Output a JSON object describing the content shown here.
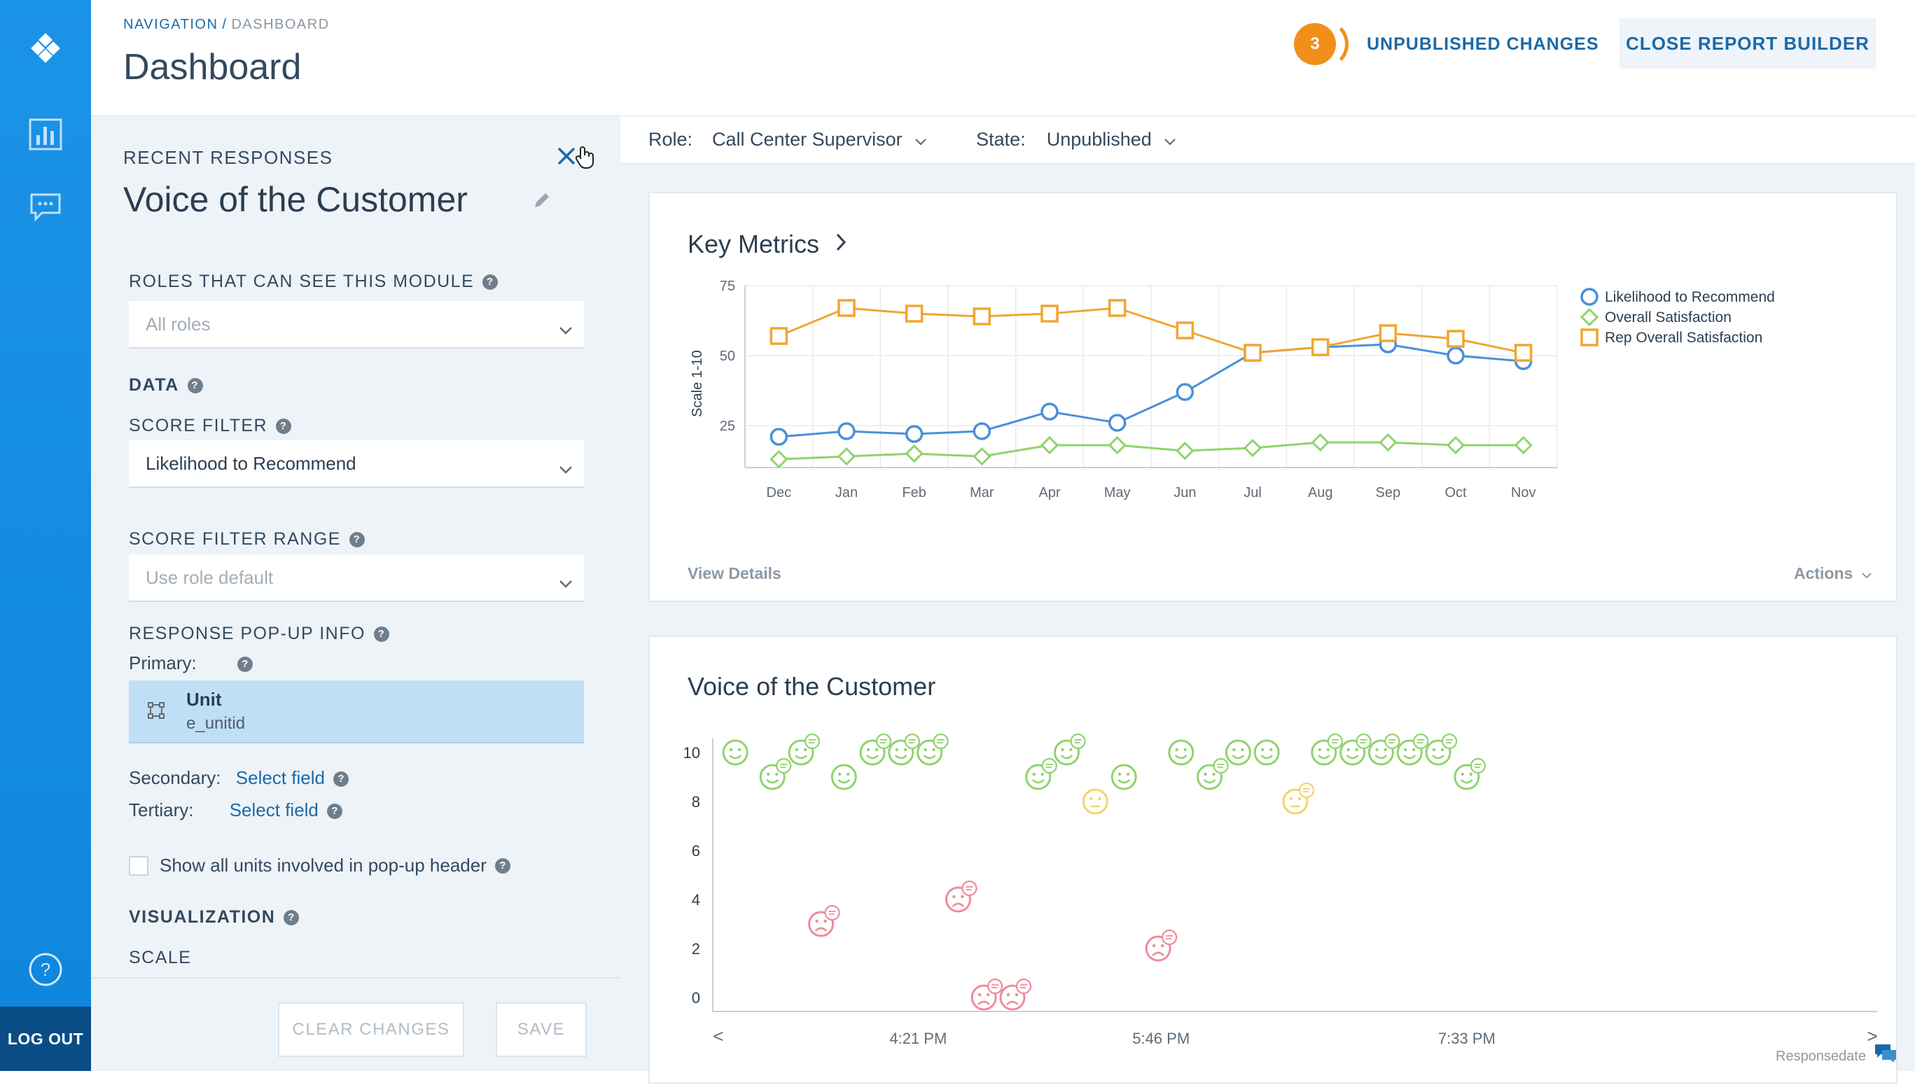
{
  "rail": {
    "icons": [
      "logo-diamond-icon",
      "bar-chart-icon",
      "chat-bubble-icon",
      "help-circle-icon"
    ],
    "logout_label": "LOG OUT"
  },
  "header": {
    "breadcrumb": {
      "parent": "NAVIGATION",
      "separator": "/",
      "current": "DASHBOARD"
    },
    "title": "Dashboard",
    "unpublished_count": "3",
    "unpublished_label": "UNPUBLISHED CHANGES",
    "close_builder_label": "CLOSE REPORT BUILDER"
  },
  "panel": {
    "section": "RECENT RESPONSES",
    "module_title": "Voice of the Customer",
    "roles_label": "ROLES THAT CAN SEE THIS MODULE",
    "roles_placeholder": "All roles",
    "data_label": "DATA",
    "score_filter_label": "SCORE FILTER",
    "score_filter_value": "Likelihood to Recommend",
    "score_range_label": "SCORE FILTER RANGE",
    "score_range_placeholder": "Use role default",
    "popup_label": "RESPONSE POP-UP INFO",
    "primary_label": "Primary:",
    "primary_field_name": "Unit",
    "primary_field_id": "e_unitid",
    "secondary_label": "Secondary:",
    "tertiary_label": "Tertiary:",
    "select_field": "Select field",
    "show_units_label": "Show all units involved in pop-up header",
    "show_units_checked": false,
    "visualization_label": "VISUALIZATION",
    "scale_label": "SCALE",
    "clear_label": "CLEAR CHANGES",
    "save_label": "SAVE"
  },
  "filters": {
    "role_label": "Role:",
    "role_value": "Call Center Supervisor",
    "state_label": "State:",
    "state_value": "Unpublished"
  },
  "key_metrics": {
    "title": "Key Metrics",
    "view_details": "View Details",
    "actions": "Actions"
  },
  "voc": {
    "title": "Voice of the Customer",
    "footer_brand": "Responsedate"
  },
  "colors": {
    "blue": "#4a90d9",
    "green": "#8ed46c",
    "orange": "#f0a630",
    "red": "#f08a9c",
    "yellow": "#f5d36a"
  },
  "chart_data": [
    {
      "type": "line",
      "title": "Key Metrics",
      "ylabel": "Scale 1-10",
      "ylim": [
        10,
        75
      ],
      "yticks": [
        25,
        50,
        75
      ],
      "categories": [
        "Dec",
        "Jan",
        "Feb",
        "Mar",
        "Apr",
        "May",
        "Jun",
        "Jul",
        "Aug",
        "Sep",
        "Oct",
        "Nov"
      ],
      "grid": true,
      "legend": "right",
      "series": [
        {
          "name": "Likelihood to Recommend",
          "marker": "circle",
          "color": "#4a90d9",
          "values": [
            21,
            23,
            22,
            23,
            30,
            26,
            37,
            51,
            53,
            54,
            50,
            48
          ]
        },
        {
          "name": "Overall Satisfaction",
          "marker": "diamond",
          "color": "#8ed46c",
          "values": [
            13,
            14,
            15,
            14,
            18,
            18,
            16,
            17,
            19,
            19,
            18,
            18
          ]
        },
        {
          "name": "Rep Overall Satisfaction",
          "marker": "square",
          "color": "#f0a630",
          "values": [
            57,
            67,
            65,
            64,
            65,
            67,
            59,
            51,
            53,
            58,
            56,
            51
          ]
        }
      ]
    },
    {
      "type": "scatter",
      "title": "Voice of the Customer",
      "ylim": [
        0,
        10
      ],
      "yticks": [
        0,
        2,
        4,
        6,
        8,
        10
      ],
      "xlim_minutes": [
        0,
        396
      ],
      "xticks": [
        {
          "label": "4:21 PM",
          "t": 66
        },
        {
          "label": "5:46 PM",
          "t": 151
        },
        {
          "label": "7:33 PM",
          "t": 258
        }
      ],
      "nav_prev": "<",
      "nav_next": ">",
      "points": [
        {
          "t": 2,
          "score": 10,
          "sentiment": "happy",
          "comment": false
        },
        {
          "t": 15,
          "score": 9,
          "sentiment": "happy",
          "comment": true
        },
        {
          "t": 25,
          "score": 10,
          "sentiment": "happy",
          "comment": true
        },
        {
          "t": 32,
          "score": 3,
          "sentiment": "sad",
          "comment": true
        },
        {
          "t": 40,
          "score": 9,
          "sentiment": "happy",
          "comment": false
        },
        {
          "t": 50,
          "score": 10,
          "sentiment": "happy",
          "comment": true
        },
        {
          "t": 60,
          "score": 10,
          "sentiment": "happy",
          "comment": true
        },
        {
          "t": 70,
          "score": 10,
          "sentiment": "happy",
          "comment": true
        },
        {
          "t": 80,
          "score": 4,
          "sentiment": "sad",
          "comment": true
        },
        {
          "t": 89,
          "score": 0,
          "sentiment": "sad",
          "comment": true
        },
        {
          "t": 99,
          "score": 0,
          "sentiment": "sad",
          "comment": true
        },
        {
          "t": 108,
          "score": 9,
          "sentiment": "happy",
          "comment": true
        },
        {
          "t": 118,
          "score": 10,
          "sentiment": "happy",
          "comment": true
        },
        {
          "t": 128,
          "score": 8,
          "sentiment": "neutral",
          "comment": false
        },
        {
          "t": 138,
          "score": 9,
          "sentiment": "happy",
          "comment": false
        },
        {
          "t": 150,
          "score": 2,
          "sentiment": "sad",
          "comment": true
        },
        {
          "t": 158,
          "score": 10,
          "sentiment": "happy",
          "comment": false
        },
        {
          "t": 168,
          "score": 9,
          "sentiment": "happy",
          "comment": true
        },
        {
          "t": 178,
          "score": 10,
          "sentiment": "happy",
          "comment": false
        },
        {
          "t": 188,
          "score": 10,
          "sentiment": "happy",
          "comment": false
        },
        {
          "t": 198,
          "score": 8,
          "sentiment": "neutral",
          "comment": true
        },
        {
          "t": 208,
          "score": 10,
          "sentiment": "happy",
          "comment": true
        },
        {
          "t": 218,
          "score": 10,
          "sentiment": "happy",
          "comment": true
        },
        {
          "t": 228,
          "score": 10,
          "sentiment": "happy",
          "comment": true
        },
        {
          "t": 238,
          "score": 10,
          "sentiment": "happy",
          "comment": true
        },
        {
          "t": 248,
          "score": 10,
          "sentiment": "happy",
          "comment": true
        },
        {
          "t": 258,
          "score": 9,
          "sentiment": "happy",
          "comment": true
        }
      ]
    }
  ]
}
